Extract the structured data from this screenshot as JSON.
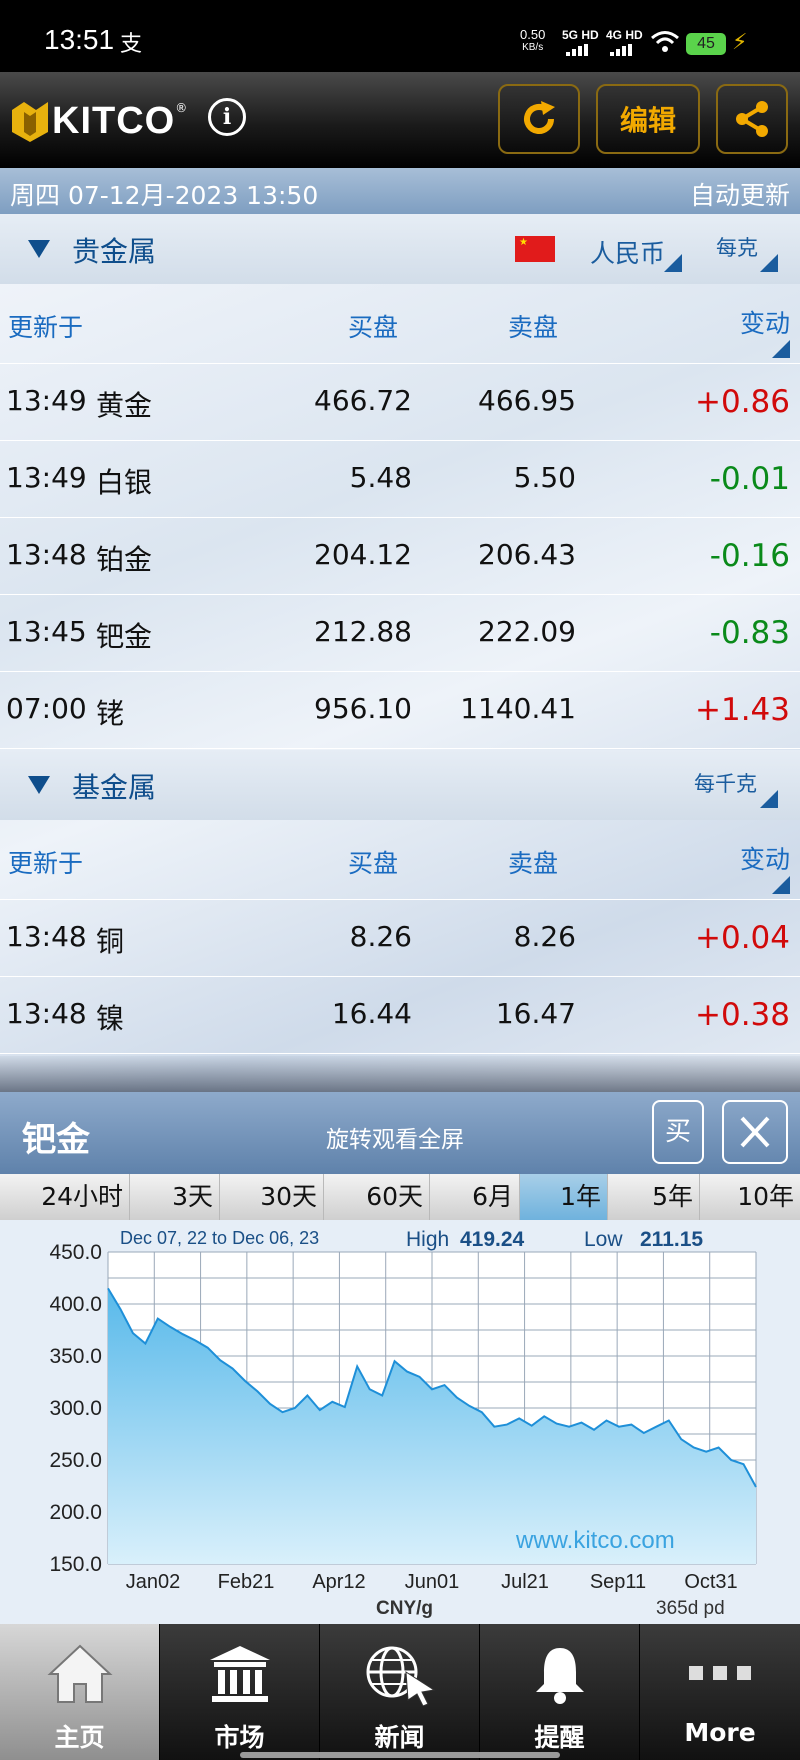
{
  "status_bar": {
    "time": "13:51",
    "app_icon": "支",
    "speed_value": "0.50",
    "speed_unit": "KB/s",
    "net1": "5G HD",
    "net2": "4G HD",
    "battery": "45"
  },
  "header": {
    "logo_text": "KITCO",
    "logo_reg": "®",
    "info_label": "i",
    "edit_label": "编辑"
  },
  "date_bar": {
    "date": "周四 07-12月-2023 13:50",
    "auto_update": "自动更新"
  },
  "precious": {
    "title": "贵金属",
    "currency": "人民币",
    "unit": "每克",
    "columns": {
      "updated": "更新于",
      "bid": "买盘",
      "ask": "卖盘",
      "change": "变动"
    },
    "rows": [
      {
        "time": "13:49",
        "name": "黄金",
        "bid": "466.72",
        "ask": "466.95",
        "change": "+0.86",
        "dir": "up"
      },
      {
        "time": "13:49",
        "name": "白银",
        "bid": "5.48",
        "ask": "5.50",
        "change": "-0.01",
        "dir": "down"
      },
      {
        "time": "13:48",
        "name": "铂金",
        "bid": "204.12",
        "ask": "206.43",
        "change": "-0.16",
        "dir": "down"
      },
      {
        "time": "13:45",
        "name": "钯金",
        "bid": "212.88",
        "ask": "222.09",
        "change": "-0.83",
        "dir": "down"
      },
      {
        "time": "07:00",
        "name": "铑",
        "bid": "956.10",
        "ask": "1140.41",
        "change": "+1.43",
        "dir": "up"
      }
    ]
  },
  "base": {
    "title": "基金属",
    "unit": "每千克",
    "columns": {
      "updated": "更新于",
      "bid": "买盘",
      "ask": "卖盘",
      "change": "变动"
    },
    "rows": [
      {
        "time": "13:48",
        "name": "铜",
        "bid": "8.26",
        "ask": "8.26",
        "change": "+0.04",
        "dir": "up"
      },
      {
        "time": "13:48",
        "name": "镍",
        "bid": "16.44",
        "ask": "16.47",
        "change": "+0.38",
        "dir": "up"
      }
    ]
  },
  "chart_panel": {
    "title": "钯金",
    "subtitle": "旋转观看全屏",
    "buy_label": "买",
    "tabs": [
      "24小时",
      "3天",
      "30天",
      "60天",
      "6月",
      "1年",
      "5年",
      "10年"
    ],
    "active_tab": "1年"
  },
  "chart_data": {
    "type": "area",
    "date_range": "Dec 07, 22 to Dec 06, 23",
    "high_label": "High",
    "high_value": "419.24",
    "low_label": "Low",
    "low_value": "211.15",
    "ylim": [
      150,
      450
    ],
    "yticks": [
      "450.0",
      "400.0",
      "350.0",
      "300.0",
      "250.0",
      "200.0",
      "150.0"
    ],
    "xticks": [
      "Jan02",
      "Feb21",
      "Apr12",
      "Jun01",
      "Jul21",
      "Sep11",
      "Oct31"
    ],
    "xlabel": "CNY/g",
    "period_note": "365d pd",
    "watermark": "www.kitco.com",
    "colors": {
      "line": "#1e8fd8",
      "fill_top": "#58b9ea",
      "fill_bottom": "#d9f0fb",
      "grid": "#9aa8b8"
    },
    "series": [
      {
        "x": [
          "Dec 07",
          "Dec 14",
          "Dec 21",
          "Dec 28",
          "Jan 04",
          "Jan 11",
          "Jan 18",
          "Jan 25",
          "Feb 01",
          "Feb 08",
          "Feb 15",
          "Feb 22",
          "Mar 01",
          "Mar 08",
          "Mar 15",
          "Mar 22",
          "Mar 29",
          "Apr 05",
          "Apr 12",
          "Apr 19",
          "Apr 26",
          "May 03",
          "May 10",
          "May 17",
          "May 24",
          "May 31",
          "Jun 07",
          "Jun 14",
          "Jun 21",
          "Jun 28",
          "Jul 05",
          "Jul 12",
          "Jul 19",
          "Jul 26",
          "Aug 02",
          "Aug 09",
          "Aug 16",
          "Aug 23",
          "Aug 30",
          "Sep 06",
          "Sep 13",
          "Sep 20",
          "Sep 27",
          "Oct 04",
          "Oct 11",
          "Oct 18",
          "Oct 25",
          "Nov 01",
          "Nov 08",
          "Nov 15",
          "Nov 22",
          "Nov 29",
          "Dec 06"
        ],
        "values": [
          415,
          395,
          372,
          362,
          386,
          378,
          371,
          365,
          358,
          346,
          338,
          326,
          316,
          304,
          296,
          300,
          312,
          298,
          306,
          301,
          340,
          318,
          312,
          345,
          335,
          330,
          318,
          322,
          310,
          302,
          296,
          282,
          284,
          290,
          283,
          292,
          285,
          282,
          286,
          279,
          288,
          282,
          284,
          276,
          282,
          288,
          270,
          262,
          258,
          262,
          250,
          246,
          224
        ]
      }
    ]
  },
  "nav": [
    {
      "label": "主页",
      "icon": "home-icon"
    },
    {
      "label": "市场",
      "icon": "bank-icon"
    },
    {
      "label": "新闻",
      "icon": "globe-cursor-icon"
    },
    {
      "label": "提醒",
      "icon": "bell-icon"
    },
    {
      "label": "More",
      "icon": "more-dots-icon"
    }
  ]
}
